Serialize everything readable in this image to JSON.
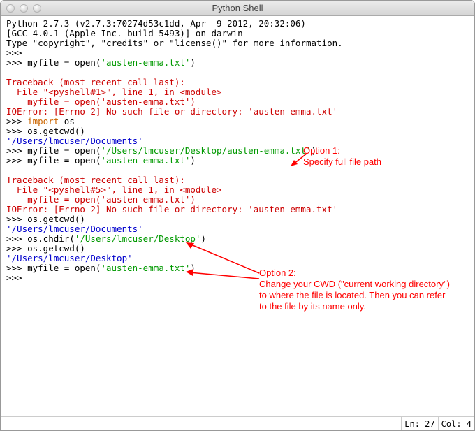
{
  "window": {
    "title": "Python Shell"
  },
  "lines": [
    {
      "segments": [
        {
          "cls": "black",
          "t": "Python 2.7.3 (v2.7.3:70274d53c1dd, Apr  9 2012, 20:32:06)"
        }
      ]
    },
    {
      "segments": [
        {
          "cls": "black",
          "t": "[GCC 4.0.1 (Apple Inc. build 5493)] on darwin"
        }
      ]
    },
    {
      "segments": [
        {
          "cls": "black",
          "t": "Type \"copyright\", \"credits\" or \"license()\" for more information."
        }
      ]
    },
    {
      "segments": [
        {
          "cls": "prompt",
          "t": ">>> "
        }
      ]
    },
    {
      "segments": [
        {
          "cls": "prompt",
          "t": ">>> "
        },
        {
          "cls": "black",
          "t": "myfile = open("
        },
        {
          "cls": "green",
          "t": "'austen-emma.txt'"
        },
        {
          "cls": "black",
          "t": ")"
        }
      ]
    },
    {
      "segments": [
        {
          "cls": "black",
          "t": ""
        }
      ]
    },
    {
      "segments": [
        {
          "cls": "red",
          "t": "Traceback (most recent call last):"
        }
      ]
    },
    {
      "segments": [
        {
          "cls": "red",
          "t": "  File \"<pyshell#1>\", line 1, in <module>"
        }
      ]
    },
    {
      "segments": [
        {
          "cls": "red",
          "t": "    myfile = open('austen-emma.txt')"
        }
      ]
    },
    {
      "segments": [
        {
          "cls": "red",
          "t": "IOError: [Errno 2] No such file or directory: 'austen-emma.txt'"
        }
      ]
    },
    {
      "segments": [
        {
          "cls": "prompt",
          "t": ">>> "
        },
        {
          "cls": "orange",
          "t": "import"
        },
        {
          "cls": "black",
          "t": " os"
        }
      ]
    },
    {
      "segments": [
        {
          "cls": "prompt",
          "t": ">>> "
        },
        {
          "cls": "black",
          "t": "os.getcwd()"
        }
      ]
    },
    {
      "segments": [
        {
          "cls": "blue",
          "t": "'/Users/lmcuser/Documents'"
        }
      ]
    },
    {
      "segments": [
        {
          "cls": "prompt",
          "t": ">>> "
        },
        {
          "cls": "black",
          "t": "myfile = open("
        },
        {
          "cls": "green",
          "t": "'/Users/lmcuser/Desktop/austen-emma.txt'"
        },
        {
          "cls": "black",
          "t": ")"
        }
      ]
    },
    {
      "segments": [
        {
          "cls": "prompt",
          "t": ">>> "
        },
        {
          "cls": "black",
          "t": "myfile = open("
        },
        {
          "cls": "green",
          "t": "'austen-emma.txt'"
        },
        {
          "cls": "black",
          "t": ")"
        }
      ]
    },
    {
      "segments": [
        {
          "cls": "black",
          "t": ""
        }
      ]
    },
    {
      "segments": [
        {
          "cls": "red",
          "t": "Traceback (most recent call last):"
        }
      ]
    },
    {
      "segments": [
        {
          "cls": "red",
          "t": "  File \"<pyshell#5>\", line 1, in <module>"
        }
      ]
    },
    {
      "segments": [
        {
          "cls": "red",
          "t": "    myfile = open('austen-emma.txt')"
        }
      ]
    },
    {
      "segments": [
        {
          "cls": "red",
          "t": "IOError: [Errno 2] No such file or directory: 'austen-emma.txt'"
        }
      ]
    },
    {
      "segments": [
        {
          "cls": "prompt",
          "t": ">>> "
        },
        {
          "cls": "black",
          "t": "os.getcwd()"
        }
      ]
    },
    {
      "segments": [
        {
          "cls": "blue",
          "t": "'/Users/lmcuser/Documents'"
        }
      ]
    },
    {
      "segments": [
        {
          "cls": "prompt",
          "t": ">>> "
        },
        {
          "cls": "black",
          "t": "os.chdir("
        },
        {
          "cls": "green",
          "t": "'/Users/lmcuser/Desktop'"
        },
        {
          "cls": "black",
          "t": ")"
        }
      ]
    },
    {
      "segments": [
        {
          "cls": "prompt",
          "t": ">>> "
        },
        {
          "cls": "black",
          "t": "os.getcwd()"
        }
      ]
    },
    {
      "segments": [
        {
          "cls": "blue",
          "t": "'/Users/lmcuser/Desktop'"
        }
      ]
    },
    {
      "segments": [
        {
          "cls": "prompt",
          "t": ">>> "
        },
        {
          "cls": "black",
          "t": "myfile = open("
        },
        {
          "cls": "green",
          "t": "'austen-emma.txt'"
        },
        {
          "cls": "black",
          "t": ")"
        }
      ]
    },
    {
      "segments": [
        {
          "cls": "prompt",
          "t": ">>> "
        }
      ]
    }
  ],
  "annotations": {
    "opt1_title": "Option 1:",
    "opt1_text": "Specify full file path",
    "opt2_title": "Option 2:",
    "opt2_text": "Change your CWD (\"current working directory\") to where the file is located. Then you can refer to the file by its name only."
  },
  "status": {
    "ln_label": "Ln: 27",
    "col_label": "Col: 4"
  }
}
